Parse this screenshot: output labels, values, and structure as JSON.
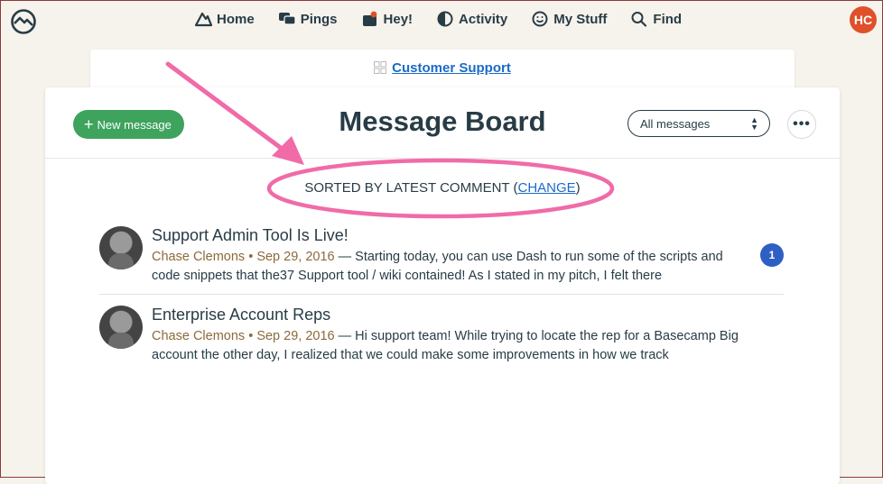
{
  "nav": {
    "items": [
      {
        "label": "Home",
        "icon": "home-icon"
      },
      {
        "label": "Pings",
        "icon": "pings-icon"
      },
      {
        "label": "Hey!",
        "icon": "hey-icon"
      },
      {
        "label": "Activity",
        "icon": "activity-icon"
      },
      {
        "label": "My Stuff",
        "icon": "my-stuff-icon"
      },
      {
        "label": "Find",
        "icon": "search-icon"
      }
    ],
    "avatar_initials": "HC"
  },
  "project": {
    "name": "Customer Support"
  },
  "board": {
    "title": "Message Board",
    "new_message_label": "New message",
    "filter_value": "All messages",
    "more_label": "•••",
    "sorted_prefix": "SORTED BY LATEST COMMENT (",
    "sorted_change": "CHANGE",
    "sorted_suffix": ")"
  },
  "messages": [
    {
      "title": "Support Admin Tool Is Live!",
      "author": "Chase Clemons",
      "date": "Sep 29, 2016",
      "excerpt": " — Starting today, you can use Dash to run some of the scripts and code snippets that the37 Support tool / wiki contained! As I stated in my pitch, I felt there",
      "comment_count": "1"
    },
    {
      "title": "Enterprise Account Reps",
      "author": "Chase Clemons",
      "date": "Sep 29, 2016",
      "excerpt": " — Hi support team! While trying to locate the rep for a Basecamp Big account the other day, I realized that we could make some improvements in how we track",
      "comment_count": ""
    }
  ],
  "colors": {
    "accent_green": "#3da35d",
    "link_blue": "#1b6ac9",
    "annotation_pink": "#f06ba8",
    "avatar_orange": "#e0502b",
    "badge_blue": "#2d5fc4"
  }
}
